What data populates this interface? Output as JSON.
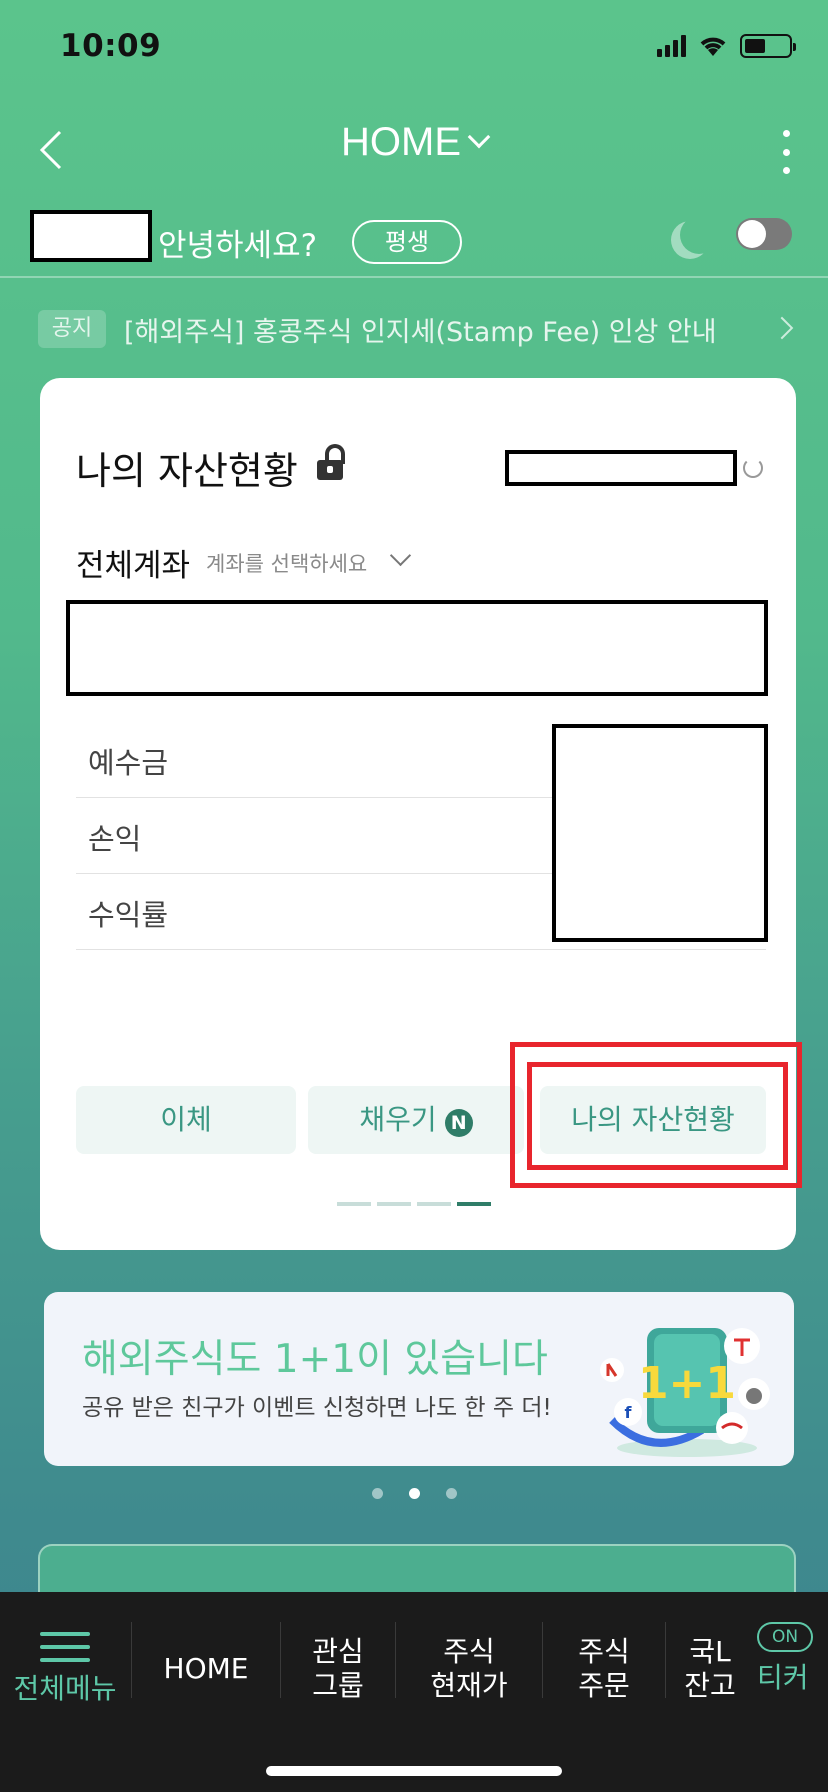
{
  "status_bar": {
    "time": "10:09"
  },
  "header": {
    "title": "HOME"
  },
  "greeting": {
    "text": "안녕하세요?",
    "badge": "평생"
  },
  "notice": {
    "tag": "공지",
    "text": "[해외주식] 홍콩주식 인지세(Stamp Fee) 인상 안내"
  },
  "asset_card": {
    "title": "나의 자산현황",
    "account_label": "전체계좌",
    "account_placeholder": "계좌를 선택하세요",
    "rows": [
      {
        "label": "예수금"
      },
      {
        "label": "손익"
      },
      {
        "label": "수익률"
      }
    ],
    "buttons": {
      "transfer": "이체",
      "fill": "채우기",
      "fill_badge": "N",
      "my_assets": "나의 자산현황"
    }
  },
  "banner": {
    "title": "해외주식도 1+1이 있습니다",
    "subtitle": "공유 받은 친구가 이벤트 신청하면 나도 한 주 더!",
    "art_text": "1+1"
  },
  "bottom_nav": {
    "items": [
      {
        "label": "전체메뉴"
      },
      {
        "label": "HOME"
      },
      {
        "line1": "관심",
        "line2": "그룹"
      },
      {
        "line1": "주식",
        "line2": "현재가"
      },
      {
        "line1": "주식",
        "line2": "주문"
      },
      {
        "line1": "국L",
        "line2": "잔고"
      }
    ],
    "ticker_toggle": "ON",
    "ticker_label": "티커"
  },
  "colors": {
    "accent_green": "#5ec89b",
    "button_text": "#3a9783",
    "highlight_red": "#e8252d",
    "nav_bg": "#1b1b1b"
  }
}
